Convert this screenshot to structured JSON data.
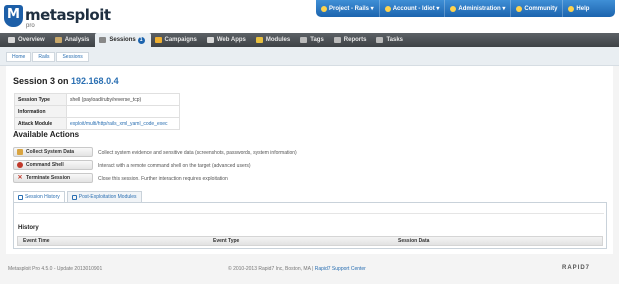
{
  "brand": {
    "name": "metasploit",
    "sub": "pro"
  },
  "topbar": {
    "items": [
      {
        "label": "Project - Rails ▾",
        "icon": "project-icon"
      },
      {
        "label": "Account - Idiot ▾",
        "icon": "account-icon"
      },
      {
        "label": "Administration ▾",
        "icon": "admin-icon"
      },
      {
        "label": "Community",
        "icon": "community-icon"
      },
      {
        "label": "Help",
        "icon": "help-icon"
      }
    ]
  },
  "tabs": [
    {
      "label": "Overview",
      "icon": "overview-icon",
      "color": "#d9d9d9"
    },
    {
      "label": "Analysis",
      "icon": "analysis-icon",
      "color": "#c9a86a"
    },
    {
      "label": "Sessions",
      "icon": "sessions-icon",
      "color": "#888888",
      "badge": "1"
    },
    {
      "label": "Campaigns",
      "icon": "campaigns-icon",
      "color": "#f0b030"
    },
    {
      "label": "Web Apps",
      "icon": "webapps-icon",
      "color": "#d9d9d9"
    },
    {
      "label": "Modules",
      "icon": "modules-icon",
      "color": "#e8c040"
    },
    {
      "label": "Tags",
      "icon": "tags-icon",
      "color": "#bbbbbb"
    },
    {
      "label": "Reports",
      "icon": "reports-icon",
      "color": "#bbbbbb"
    },
    {
      "label": "Tasks",
      "icon": "tasks-icon",
      "color": "#bbbbbb"
    }
  ],
  "breadcrumbs": [
    "Home",
    "Rails",
    "Sessions"
  ],
  "session": {
    "title_prefix": "Session 3 on ",
    "ip": "192.168.0.4",
    "info": [
      {
        "key": "Session Type",
        "value": "shell (payload/ruby/reverse_tcp)"
      },
      {
        "key": "Information",
        "value": ""
      },
      {
        "key": "Attack Module",
        "value": "exploit/multi/http/rails_xml_yaml_code_exec"
      }
    ]
  },
  "actions": {
    "title": "Available Actions",
    "items": [
      {
        "label": "Collect System Data",
        "icon": "collect-icon",
        "desc": "Collect system evidence and sensitive data (screenshots, passwords, system information)"
      },
      {
        "label": "Command Shell",
        "icon": "shell-icon",
        "desc": "Interact with a remote command shell on the target (advanced users)"
      },
      {
        "label": "Terminate Session",
        "icon": "terminate-icon",
        "desc": "Close this session. Further interaction requires exploitation"
      }
    ]
  },
  "subtabs": [
    "Session History",
    "Post-Exploitation Modules"
  ],
  "history": {
    "title": "History",
    "columns": [
      "Event Time",
      "Event Type",
      "Session Data"
    ]
  },
  "footer": {
    "version": "Metasploit Pro 4.5.0 - Update 2013010901",
    "copyright": "© 2010-2013 Rapid7 Inc, Boston, MA |",
    "support": "Rapid7 Support Center",
    "brand": "RAPID7"
  },
  "colors": {
    "accent": "#1d64ae",
    "link": "#2a6fb2",
    "nav_dark": "#3e4246"
  }
}
